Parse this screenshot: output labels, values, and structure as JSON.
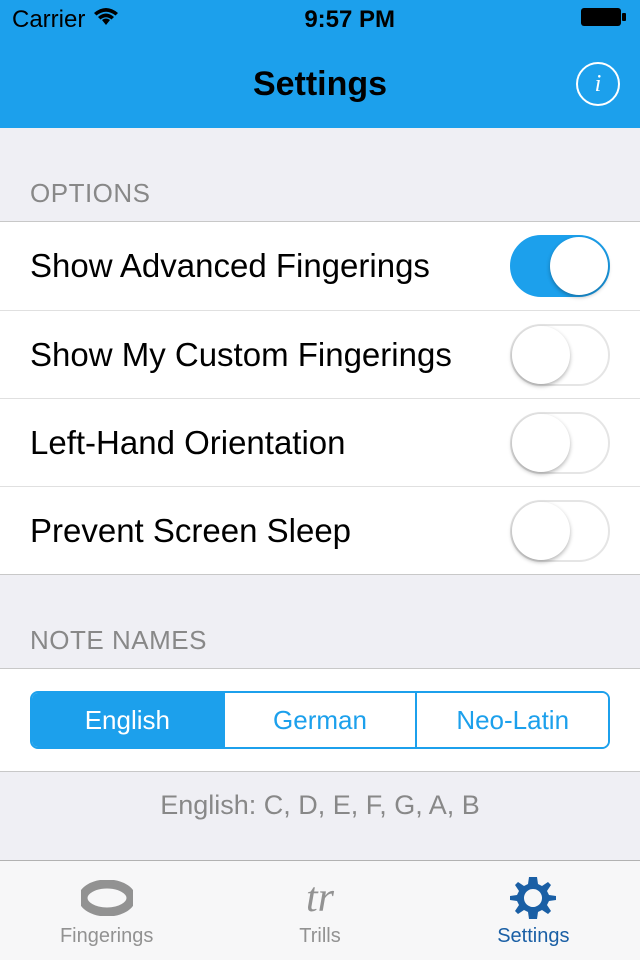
{
  "status": {
    "carrier": "Carrier",
    "time": "9:57 PM"
  },
  "nav": {
    "title": "Settings",
    "info_label": "i"
  },
  "options": {
    "header": "OPTIONS",
    "items": [
      {
        "label": "Show Advanced Fingerings",
        "on": true
      },
      {
        "label": "Show My Custom Fingerings",
        "on": false
      },
      {
        "label": "Left-Hand Orientation",
        "on": false
      },
      {
        "label": "Prevent Screen Sleep",
        "on": false
      }
    ]
  },
  "note_names": {
    "header": "NOTE NAMES",
    "segments": [
      "English",
      "German",
      "Neo-Latin"
    ],
    "selected_index": 0,
    "description": "English: C, D, E, F, G, A, B"
  },
  "tabs": {
    "items": [
      {
        "label": "Fingerings",
        "icon": "oval-icon",
        "active": false
      },
      {
        "label": "Trills",
        "icon": "trills-icon",
        "active": false
      },
      {
        "label": "Settings",
        "icon": "gear-icon",
        "active": true
      }
    ]
  }
}
